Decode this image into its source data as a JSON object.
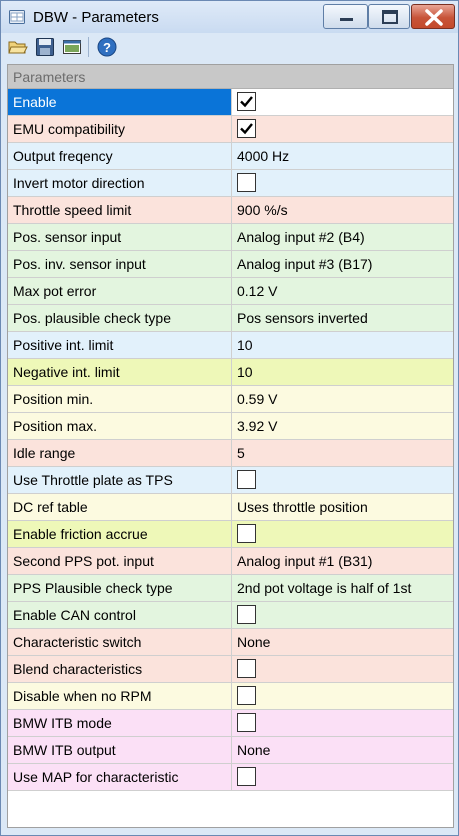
{
  "window": {
    "title": "DBW - Parameters"
  },
  "toolbar": {
    "icons": [
      "folder-open-icon",
      "save-icon",
      "window-icon",
      "help-icon"
    ]
  },
  "section": {
    "label": "Parameters"
  },
  "rows": [
    {
      "name": "Enable",
      "type": "checkbox",
      "checked": true,
      "color": "#ffffff"
    },
    {
      "name": "EMU compatibility",
      "type": "checkbox",
      "checked": true,
      "color": "#fbe3dc"
    },
    {
      "name": "Output freqency",
      "type": "text",
      "value": "4000 Hz",
      "color": "#e2f1fb"
    },
    {
      "name": "Invert motor direction",
      "type": "checkbox",
      "checked": false,
      "color": "#e2f1fb"
    },
    {
      "name": "Throttle speed limit",
      "type": "text",
      "value": "900 %/s",
      "color": "#fbe3dc"
    },
    {
      "name": "Pos. sensor input",
      "type": "text",
      "value": "Analog input #2 (B4)",
      "color": "#e3f5df"
    },
    {
      "name": "Pos. inv. sensor input",
      "type": "text",
      "value": "Analog input #3 (B17)",
      "color": "#e3f5df"
    },
    {
      "name": "Max pot error",
      "type": "text",
      "value": "0.12 V",
      "color": "#e3f5df"
    },
    {
      "name": "Pos. plausible check type",
      "type": "text",
      "value": "Pos sensors inverted",
      "color": "#e3f5df"
    },
    {
      "name": "Positive int. limit",
      "type": "text",
      "value": "10",
      "color": "#e2f1fb"
    },
    {
      "name": "Negative int. limit",
      "type": "text",
      "value": "10",
      "color": "#eef8b8"
    },
    {
      "name": "Position min.",
      "type": "text",
      "value": "0.59 V",
      "color": "#fcfae0"
    },
    {
      "name": "Position max.",
      "type": "text",
      "value": "3.92 V",
      "color": "#fcfae0"
    },
    {
      "name": "Idle range",
      "type": "text",
      "value": "5",
      "color": "#fbe3dc"
    },
    {
      "name": "Use Throttle plate as TPS",
      "type": "checkbox",
      "checked": false,
      "color": "#e2f1fb"
    },
    {
      "name": "DC ref table",
      "type": "text",
      "value": "Uses throttle position",
      "color": "#fcfae0"
    },
    {
      "name": "Enable friction accrue",
      "type": "checkbox",
      "checked": false,
      "color": "#eef8b8"
    },
    {
      "name": "Second PPS pot. input",
      "type": "text",
      "value": "Analog input #1 (B31)",
      "color": "#fbe3dc"
    },
    {
      "name": "PPS Plausible check type",
      "type": "text",
      "value": "2nd pot voltage is half of 1st",
      "color": "#e3f5df"
    },
    {
      "name": "Enable CAN control",
      "type": "checkbox",
      "checked": false,
      "color": "#e3f5df"
    },
    {
      "name": "Characteristic switch",
      "type": "text",
      "value": "None",
      "color": "#fbe3dc"
    },
    {
      "name": "Blend characteristics",
      "type": "checkbox",
      "checked": false,
      "color": "#fbe3dc"
    },
    {
      "name": "Disable when no RPM",
      "type": "checkbox",
      "checked": false,
      "color": "#fcfae0"
    },
    {
      "name": "BMW ITB mode",
      "type": "checkbox",
      "checked": false,
      "color": "#fbe0f6"
    },
    {
      "name": "BMW ITB output",
      "type": "text",
      "value": "None",
      "color": "#fbe0f6"
    },
    {
      "name": "Use MAP for characteristic",
      "type": "checkbox",
      "checked": false,
      "color": "#fbe0f6"
    }
  ]
}
